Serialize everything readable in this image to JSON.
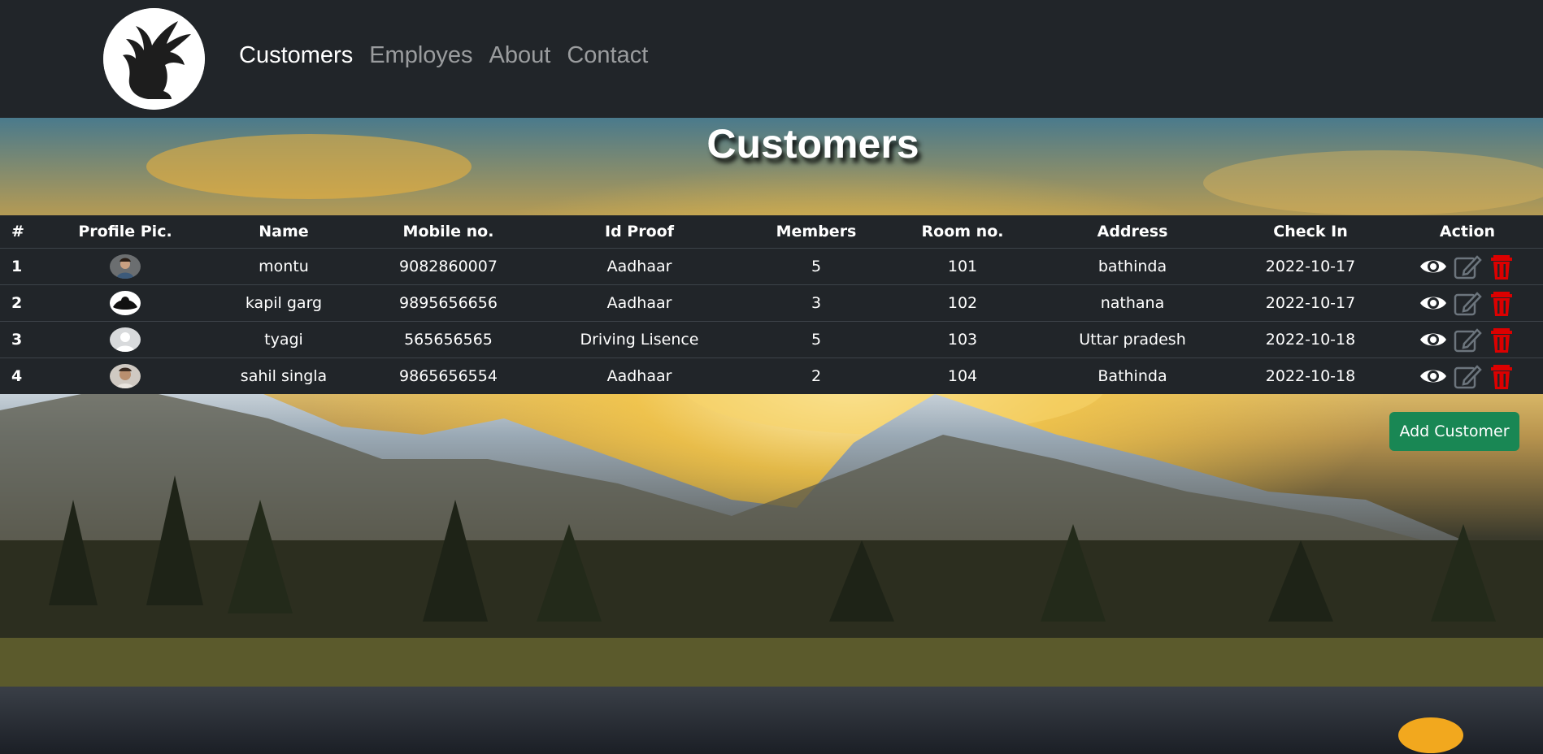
{
  "nav": {
    "logo_icon": "griffin-logo-icon",
    "links": [
      {
        "label": "Customers",
        "active": true
      },
      {
        "label": "Employes",
        "active": false
      },
      {
        "label": "About",
        "active": false
      },
      {
        "label": "Contact",
        "active": false
      }
    ]
  },
  "page": {
    "title": "Customers"
  },
  "table": {
    "headers": [
      "#",
      "Profile Pic.",
      "Name",
      "Mobile no.",
      "Id Proof",
      "Members",
      "Room no.",
      "Address",
      "Check In",
      "Action"
    ],
    "rows": [
      {
        "num": "1",
        "name": "montu",
        "mobile": "9082860007",
        "id_proof": "Aadhaar",
        "members": "5",
        "room": "101",
        "address": "bathinda",
        "check_in": "2022-10-17"
      },
      {
        "num": "2",
        "name": "kapil garg",
        "mobile": "9895656656",
        "id_proof": "Aadhaar",
        "members": "3",
        "room": "102",
        "address": "nathana",
        "check_in": "2022-10-17"
      },
      {
        "num": "3",
        "name": "tyagi",
        "mobile": "565656565",
        "id_proof": "Driving Lisence",
        "members": "5",
        "room": "103",
        "address": "Uttar pradesh",
        "check_in": "2022-10-18"
      },
      {
        "num": "4",
        "name": "sahil singla",
        "mobile": "9865656554",
        "id_proof": "Aadhaar",
        "members": "2",
        "room": "104",
        "address": "Bathinda",
        "check_in": "2022-10-18"
      }
    ],
    "action_icons": [
      "eye-icon",
      "edit-icon",
      "trash-icon"
    ]
  },
  "add_button": {
    "label": "Add Customer"
  },
  "colors": {
    "navbar": "#212529",
    "success": "#198754",
    "delete": "#dc0000",
    "edit": "#6c757d"
  }
}
